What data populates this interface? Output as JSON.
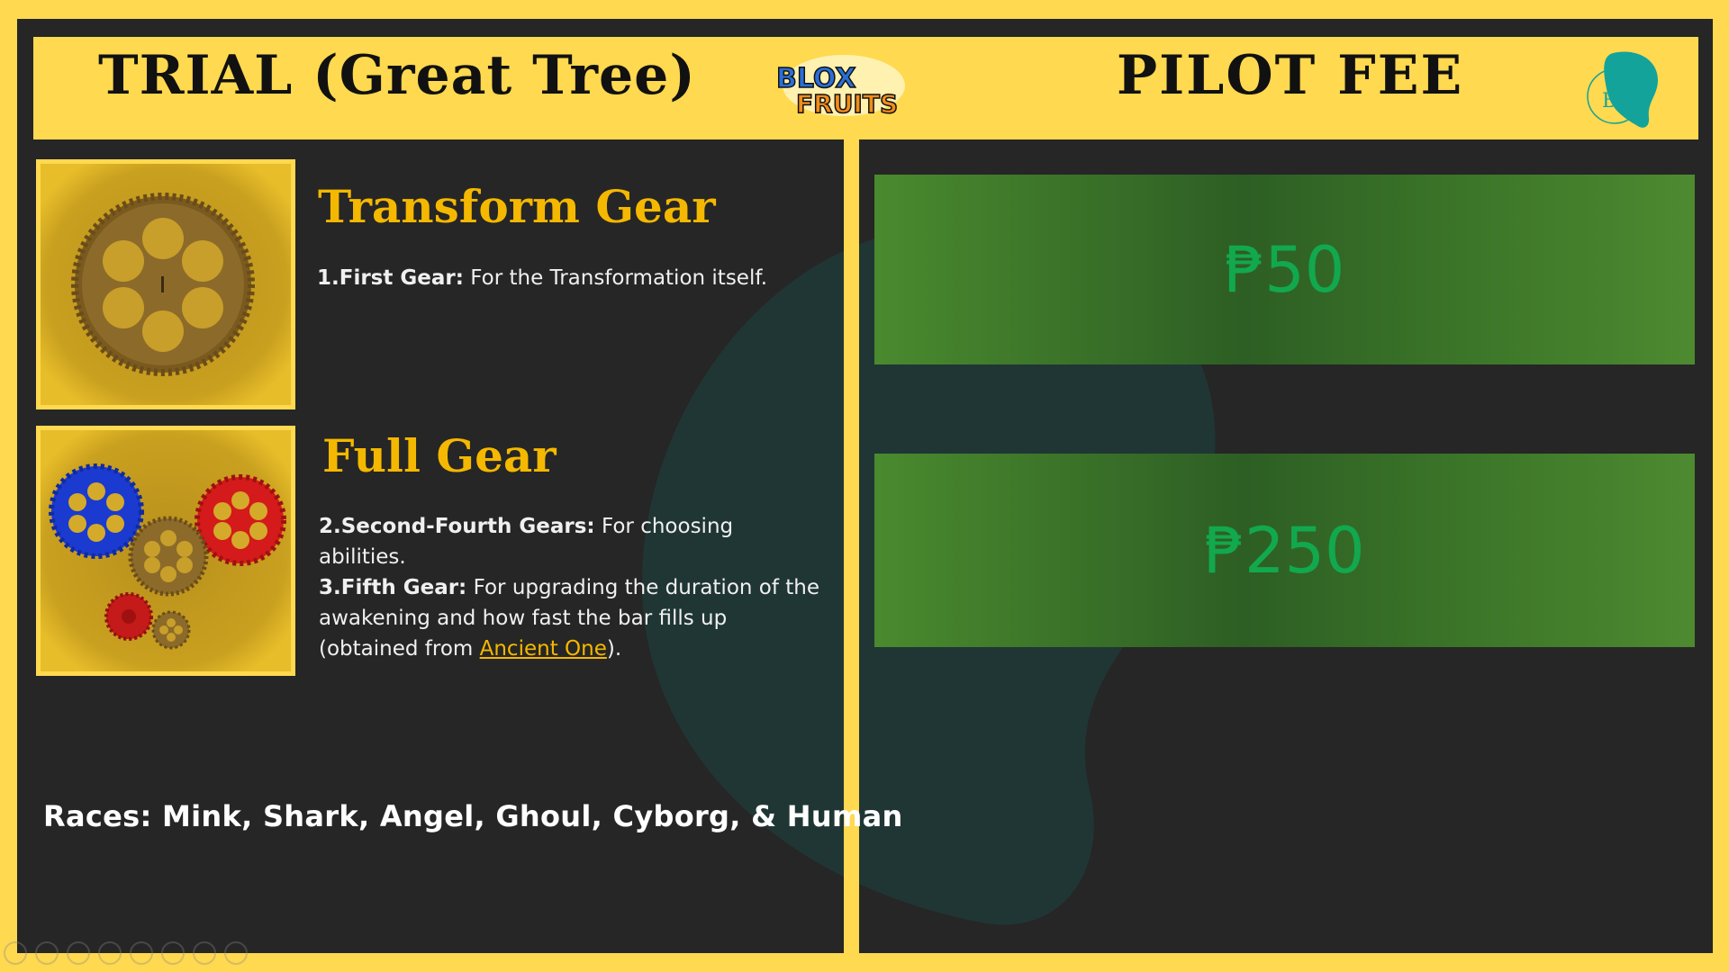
{
  "header": {
    "left_title": "TRIAL (Great Tree)",
    "right_title": "PILOT FEE",
    "logo_line1": "BLOX",
    "logo_line2": "FRUITS",
    "bc_logo_text": "BC"
  },
  "gears": [
    {
      "title": "Transform Gear",
      "lines": [
        {
          "label": "1.First Gear:",
          "text": " For the Transformation itself."
        }
      ]
    },
    {
      "title": "Full Gear",
      "lines": [
        {
          "label": "2.Second-Fourth Gears:",
          "text": " For choosing abilities."
        },
        {
          "label": "3.Fifth Gear:",
          "text": " For upgrading the duration of the awakening and how fast the bar fills up (obtained from ",
          "link": "Ancient One",
          "after": ")."
        }
      ]
    }
  ],
  "races": "Races: Mink, Shark, Angel, Ghoul, Cyborg, & Human",
  "fees": [
    "₱50",
    "₱250"
  ],
  "colors": {
    "accent": "#ffd94f",
    "gear_title": "#f5b800",
    "fee_text": "#12a84e",
    "background": "#262626"
  }
}
